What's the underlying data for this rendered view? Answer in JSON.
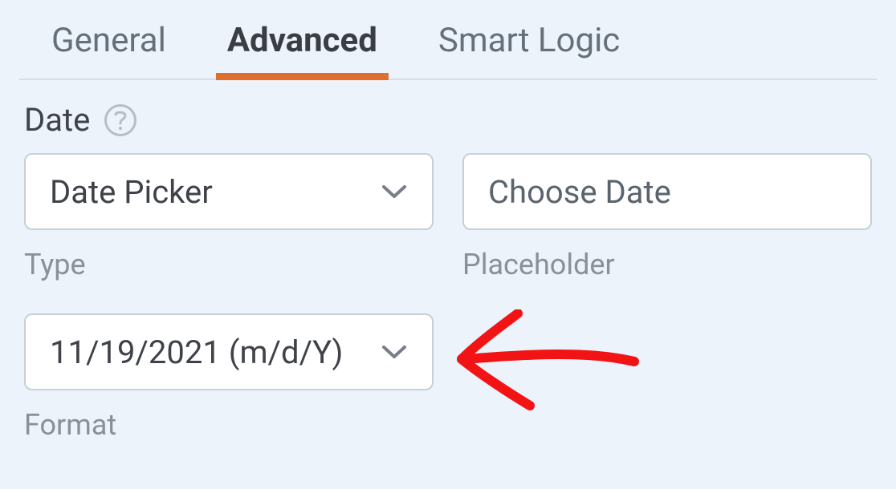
{
  "tabs": {
    "general": "General",
    "advanced": "Advanced",
    "smart_logic": "Smart Logic"
  },
  "section": {
    "title": "Date"
  },
  "fields": {
    "type": {
      "value": "Date Picker",
      "label": "Type"
    },
    "placeholder": {
      "value": "Choose Date",
      "label": "Placeholder"
    },
    "format": {
      "value": "11/19/2021 (m/d/Y)",
      "label": "Format"
    }
  }
}
